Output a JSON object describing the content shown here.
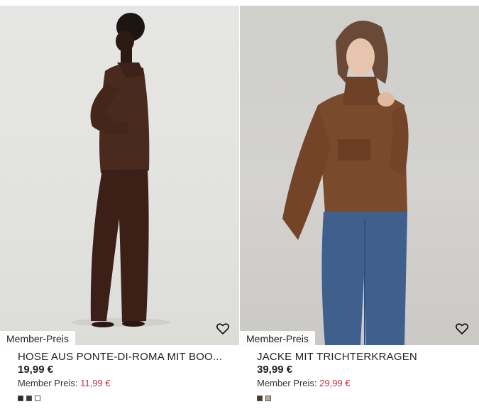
{
  "products": [
    {
      "badge": "Member-Preis",
      "title": "HOSE AUS PONTE-DI-ROMA MIT BOO...",
      "price": "19,99 €",
      "member_label": "Member Preis:",
      "member_price": "11,99 €",
      "favorite_icon": "heart-outline-icon",
      "swatches": [
        "#2a2a2a",
        "#3a3a3a",
        "#ffffff"
      ]
    },
    {
      "badge": "Member-Preis",
      "title": "JACKE MIT TRICHTERKRAGEN",
      "price": "39,99 €",
      "member_label": "Member Preis:",
      "member_price": "29,99 €",
      "favorite_icon": "heart-outline-icon",
      "swatches": [
        "#4a3a2e",
        "#b8a898"
      ]
    }
  ],
  "colors": {
    "member_price": "#d0283e",
    "brown_outfit": "#4a2a1f",
    "denim": "#3f5f8c"
  }
}
